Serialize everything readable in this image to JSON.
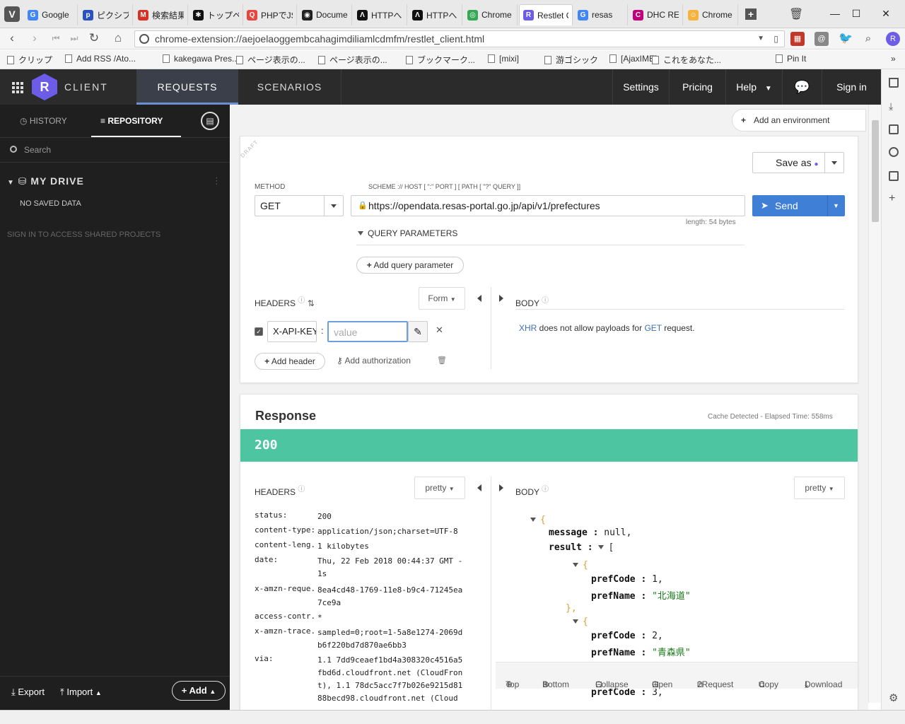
{
  "browser": {
    "tabs": [
      {
        "label": "Google",
        "color": "#4285f4",
        "glyph": "G"
      },
      {
        "label": "ピクシブ",
        "color": "#2a52be",
        "glyph": "p"
      },
      {
        "label": "検索結果",
        "color": "#d93025",
        "glyph": "M"
      },
      {
        "label": "トップページ",
        "color": "#111111",
        "glyph": "✱"
      },
      {
        "label": "PHPでJS",
        "color": "#e8453c",
        "glyph": "Q"
      },
      {
        "label": "Document",
        "color": "#222222",
        "glyph": "◉"
      },
      {
        "label": "HTTPへ",
        "color": "#111111",
        "glyph": "Λ"
      },
      {
        "label": "HTTPへ",
        "color": "#111111",
        "glyph": "Λ"
      },
      {
        "label": "Chrome",
        "color": "#34a853",
        "glyph": "◎"
      },
      {
        "label": "Restlet Client",
        "color": "#6c5ce7",
        "glyph": "R"
      },
      {
        "label": "resas",
        "color": "#4285f4",
        "glyph": "G"
      },
      {
        "label": "DHC REST",
        "color": "#c0007a",
        "glyph": "C"
      },
      {
        "label": "Chrome",
        "color": "#f6b33c",
        "glyph": "☺"
      }
    ],
    "url": "chrome-extension://aejoelaoggembcahagimdiliamlcdmfm/restlet_client.html",
    "bookmarks": [
      "クリップ",
      "Add RSS /Ato...",
      "kakegawa Pres...",
      "ページ表示の...",
      "ページ表示の...",
      "ブックマーク...",
      "[mixi]",
      "游ゴシック",
      "[AjaxIME]",
      "これをあなた...",
      "Pin It"
    ]
  },
  "header": {
    "logo_letter": "R",
    "app_name": "CLIENT",
    "tabs": {
      "requests": "REQUESTS",
      "scenarios": "SCENARIOS"
    },
    "links": {
      "settings": "Settings",
      "pricing": "Pricing",
      "help": "Help",
      "signin": "Sign in"
    }
  },
  "sidebar": {
    "tabs": {
      "history": "HISTORY",
      "repository": "REPOSITORY"
    },
    "search_placeholder": "Search",
    "drive_title": "MY DRIVE",
    "no_data": "NO SAVED DATA",
    "shared_hint": "SIGN IN TO ACCESS SHARED PROJECTS",
    "footer": {
      "export": "Export",
      "import": "Import",
      "add": "Add"
    }
  },
  "request": {
    "env_button": "Add an environment",
    "draft": "DRAFT",
    "save_as": "Save as",
    "method_label": "METHOD",
    "method": "GET",
    "scheme_label": "SCHEME :// HOST [ \":\" PORT ] [ PATH [ \"?\" QUERY ]]",
    "url": "https://opendata.resas-portal.go.jp/api/v1/prefectures",
    "length": "length: 54 bytes",
    "send": "Send",
    "query_params": "QUERY PARAMETERS",
    "add_query": "Add query parameter",
    "headers_label": "HEADERS",
    "form_select": "Form",
    "header_key": "X-API-KEY",
    "header_value_placeholder": "value",
    "add_header": "Add header",
    "add_auth": "Add authorization",
    "body_label": "BODY",
    "body_msg": {
      "xhr": "XHR",
      "mid": " does not allow payloads for ",
      "get": "GET",
      "end": " request."
    }
  },
  "response": {
    "title": "Response",
    "meta": "Cache Detected - Elapsed Time: 558ms",
    "status": "200",
    "status_color": "#4dc5a0",
    "headers_label": "HEADERS",
    "body_label": "BODY",
    "pretty": "pretty",
    "headers": [
      {
        "k": "status:",
        "v": "200"
      },
      {
        "k": "content-type:",
        "v": "application/json;charset=UTF-8"
      },
      {
        "k": "content-leng...",
        "v": "1 kilobytes"
      },
      {
        "k": "date:",
        "v": "Thu, 22 Feb 2018 00:44:37 GMT -1s"
      },
      {
        "k": "x-amzn-reque...",
        "v": "8ea4cd48-1769-11e8-b9c4-71245ea7ce9a"
      },
      {
        "k": "access-contr...",
        "v": "*"
      },
      {
        "k": "x-amzn-trace...",
        "v": "sampled=0;root=1-5a8e1274-2069db6f220bd7d870ae6bb3"
      },
      {
        "k": "via:",
        "v": "1.1 7dd9ceaef1bd4a308320c4516a5fbd6d.cloudfront.net (CloudFront), 1.1 78dc5acc7f7b026e9215d8188becd98.cloudfront.net (Cloud"
      }
    ],
    "json": {
      "open": "{",
      "message_key": "message :",
      "message_val": "null,",
      "result_key": "result :",
      "arr_open": "[",
      "items": [
        {
          "code_key": "prefCode :",
          "code": "1,",
          "name_key": "prefName :",
          "name": "\"北海道\""
        },
        {
          "code_key": "prefCode :",
          "code": "2,",
          "name_key": "prefName :",
          "name": "\"青森県\""
        },
        {
          "code_key": "prefCode :",
          "code": "3,"
        }
      ],
      "obj_open": "{",
      "obj_close": "},"
    },
    "toolbar": {
      "top": "Top",
      "bottom": "Bottom",
      "collapse": "Collapse",
      "open": "Open",
      "torequest": "2Request",
      "copy": "Copy",
      "download": "Download"
    }
  }
}
